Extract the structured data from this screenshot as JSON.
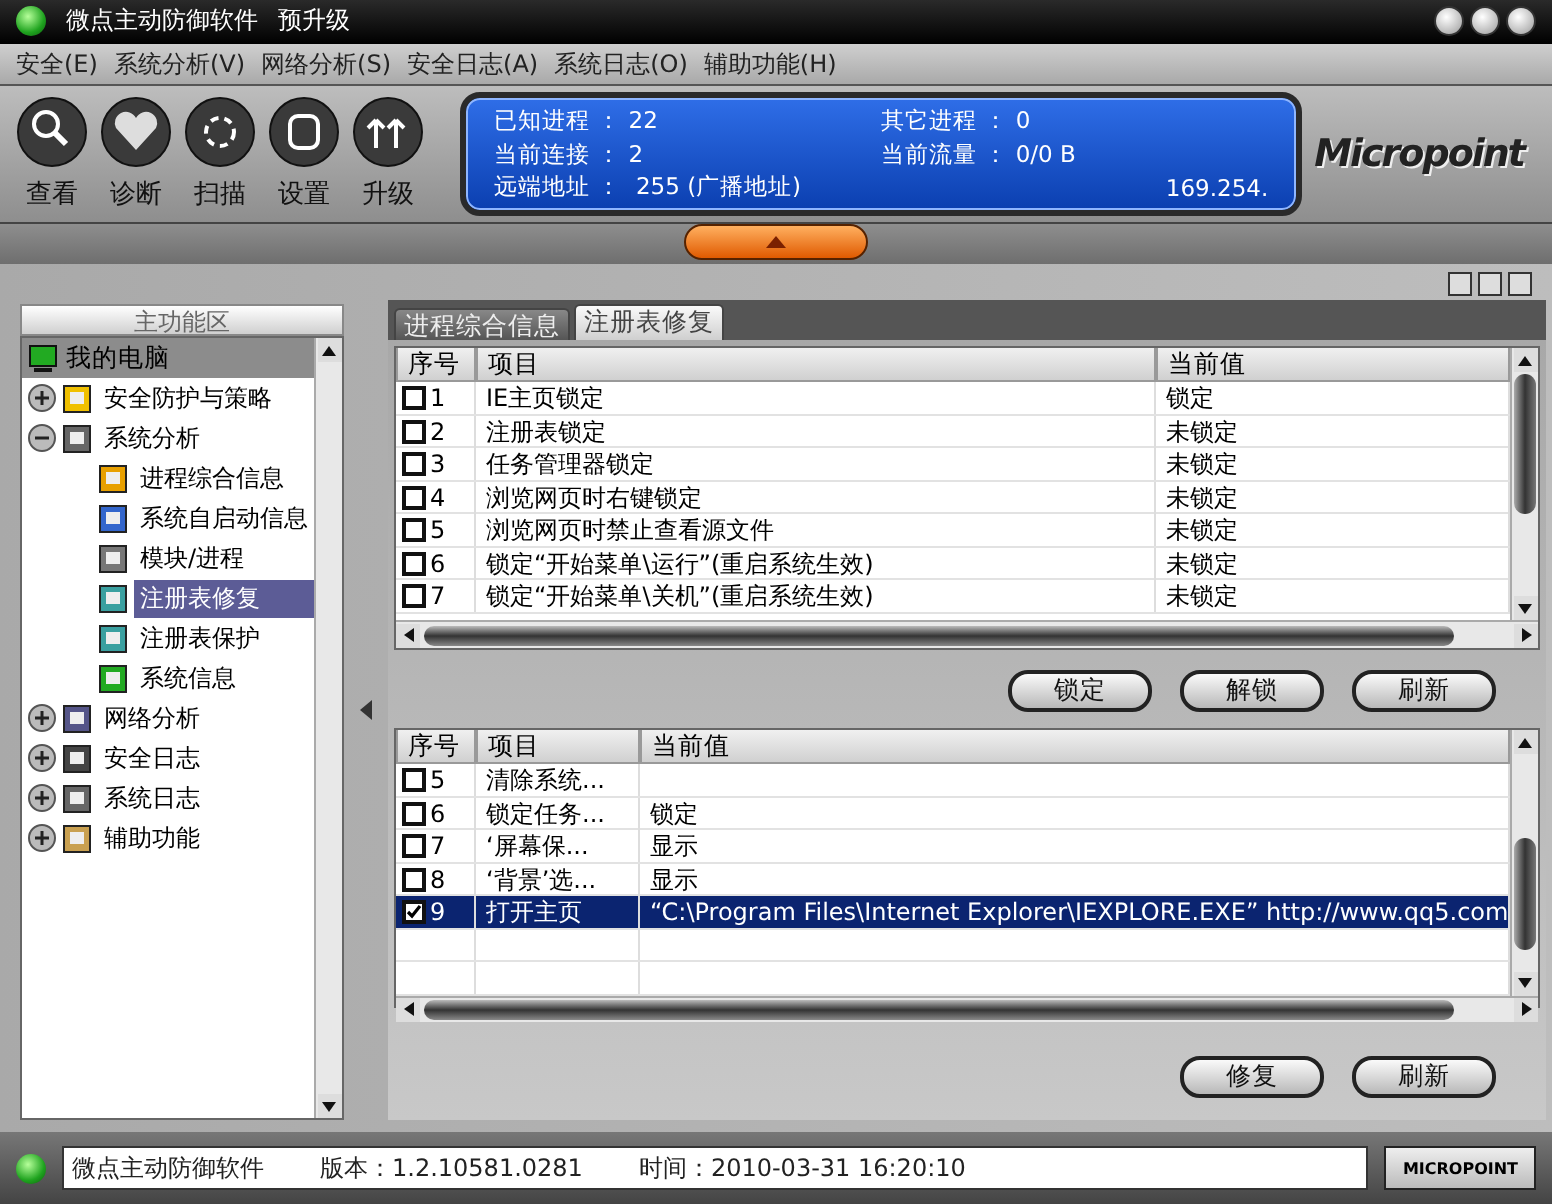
{
  "window": {
    "title": "微点主动防御软件",
    "subtitle": "预升级"
  },
  "menu": [
    "安全(E)",
    "系统分析(V)",
    "网络分析(S)",
    "安全日志(A)",
    "系统日志(O)",
    "辅助功能(H)"
  ],
  "toolbar": [
    "查看",
    "诊断",
    "扫描",
    "设置",
    "升级"
  ],
  "stats": [
    "已知进程 ： 22",
    "其它进程 ： 0",
    "当前连接 ： 2",
    "当前流量 ： 0/0 B",
    "远端地址 ：  255 (广播地址)",
    "169.254."
  ],
  "logo": "Micropoint",
  "sidebar": {
    "title": "主功能区",
    "root": "我的电脑",
    "items": [
      {
        "label": "安全防护与策略",
        "expanded": false
      },
      {
        "label": "系统分析",
        "expanded": true,
        "children": [
          {
            "label": "进程综合信息",
            "selected": false
          },
          {
            "label": "系统自启动信息",
            "selected": false
          },
          {
            "label": "模块/进程",
            "selected": false
          },
          {
            "label": "注册表修复",
            "selected": true
          },
          {
            "label": "注册表保护",
            "selected": false
          },
          {
            "label": "系统信息",
            "selected": false
          }
        ]
      },
      {
        "label": "网络分析",
        "expanded": false
      },
      {
        "label": "安全日志",
        "expanded": false
      },
      {
        "label": "系统日志",
        "expanded": false
      },
      {
        "label": "辅助功能",
        "expanded": false
      }
    ]
  },
  "tabs": [
    {
      "label": "进程综合信息",
      "selected": false
    },
    {
      "label": "注册表修复",
      "selected": true
    }
  ],
  "top_table": {
    "columns": [
      "序号",
      "项目",
      "当前值"
    ],
    "rows": [
      {
        "no": "1",
        "item": "IE主页锁定",
        "value": "锁定",
        "checked": false
      },
      {
        "no": "2",
        "item": "注册表锁定",
        "value": "未锁定",
        "checked": false
      },
      {
        "no": "3",
        "item": "任务管理器锁定",
        "value": "未锁定",
        "checked": false
      },
      {
        "no": "4",
        "item": "浏览网页时右键锁定",
        "value": "未锁定",
        "checked": false
      },
      {
        "no": "5",
        "item": "浏览网页时禁止查看源文件",
        "value": "未锁定",
        "checked": false
      },
      {
        "no": "6",
        "item": "锁定“开始菜单\\运行”(重启系统生效)",
        "value": "未锁定",
        "checked": false
      },
      {
        "no": "7",
        "item": "锁定“开始菜单\\关机”(重启系统生效)",
        "value": "未锁定",
        "checked": false
      }
    ],
    "buttons": [
      "锁定",
      "解锁",
      "刷新"
    ]
  },
  "bottom_table": {
    "columns": [
      "序号",
      "项目",
      "当前值"
    ],
    "rows": [
      {
        "no": "5",
        "item": "清除系统...",
        "value": "",
        "checked": false,
        "selected": false
      },
      {
        "no": "6",
        "item": "锁定任务...",
        "value": "锁定",
        "checked": false,
        "selected": false
      },
      {
        "no": "7",
        "item": "‘屏幕保...",
        "value": "显示",
        "checked": false,
        "selected": false
      },
      {
        "no": "8",
        "item": "‘背景’选...",
        "value": "显示",
        "checked": false,
        "selected": false
      },
      {
        "no": "9",
        "item": "打开主页",
        "value": "“C:\\Program Files\\Internet Explorer\\IEXPLORE.EXE” http://www.qq5.com",
        "checked": true,
        "selected": true
      }
    ],
    "buttons": [
      "修复",
      "刷新"
    ]
  },
  "status_bar": {
    "app": "微点主动防御软件",
    "version": "版本：1.2.10581.0281",
    "time": "时间：2010-03-31 16:20:10",
    "logo": "MICROPOINT"
  }
}
